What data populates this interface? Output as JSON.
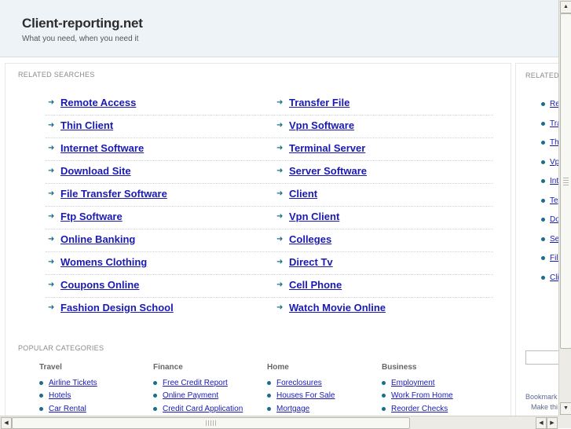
{
  "header": {
    "title": "Client-reporting.net",
    "tagline": "What you need, when you need it"
  },
  "related": {
    "label": "RELATED SEARCHES",
    "arrow": "➜",
    "left": [
      "Remote Access",
      "Thin Client",
      "Internet Software",
      "Download Site",
      "File Transfer Software",
      "Ftp Software",
      "Online Banking",
      "Womens Clothing",
      "Coupons Online",
      "Fashion Design School"
    ],
    "right": [
      "Transfer File",
      "Vpn Software",
      "Terminal Server",
      "Server Software",
      "Client",
      "Vpn Client",
      "Colleges",
      "Direct Tv",
      "Cell Phone",
      "Watch Movie Online"
    ]
  },
  "popular": {
    "label": "POPULAR CATEGORIES",
    "columns": [
      {
        "heading": "Travel",
        "items": [
          "Airline Tickets",
          "Hotels",
          "Car Rental"
        ]
      },
      {
        "heading": "Finance",
        "items": [
          "Free Credit Report",
          "Online Payment",
          "Credit Card Application"
        ]
      },
      {
        "heading": "Home",
        "items": [
          "Foreclosures",
          "Houses For Sale",
          "Mortgage"
        ]
      },
      {
        "heading": "Business",
        "items": [
          "Employment",
          "Work From Home",
          "Reorder Checks"
        ]
      }
    ]
  },
  "side": {
    "label": "RELATED",
    "items": [
      "Re",
      "Tra",
      "Th",
      "Vp",
      "Inte",
      "Te",
      "Do",
      "Se",
      "File",
      "Cli"
    ],
    "bookmark": "Bookmark",
    "make": "Make thi"
  },
  "scroll": {
    "up": "▲",
    "down": "▼",
    "left": "◀",
    "prev": "◀",
    "next": "▶"
  }
}
